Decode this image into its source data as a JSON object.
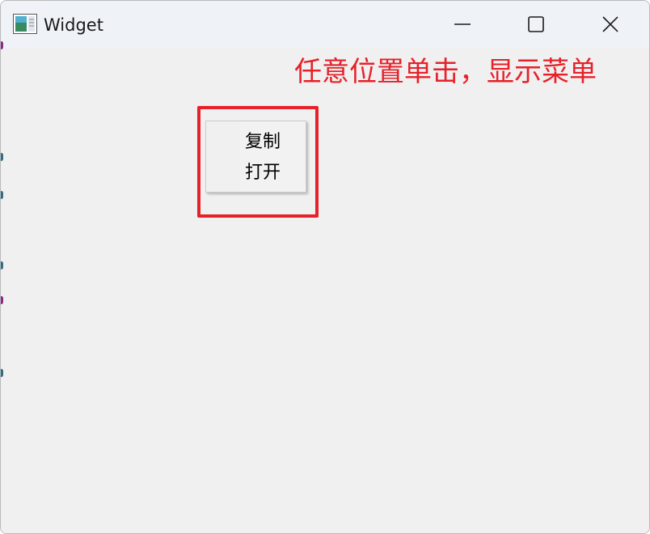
{
  "window": {
    "title": "Widget",
    "controls": {
      "minimize_icon": "minimize-icon",
      "maximize_icon": "maximize-icon",
      "close_icon": "close-icon"
    }
  },
  "annotation": {
    "text": "任意位置单击，显示菜单",
    "color": "#e6212a"
  },
  "context_menu": {
    "items": [
      {
        "label": "复制"
      },
      {
        "label": "打开"
      }
    ]
  }
}
